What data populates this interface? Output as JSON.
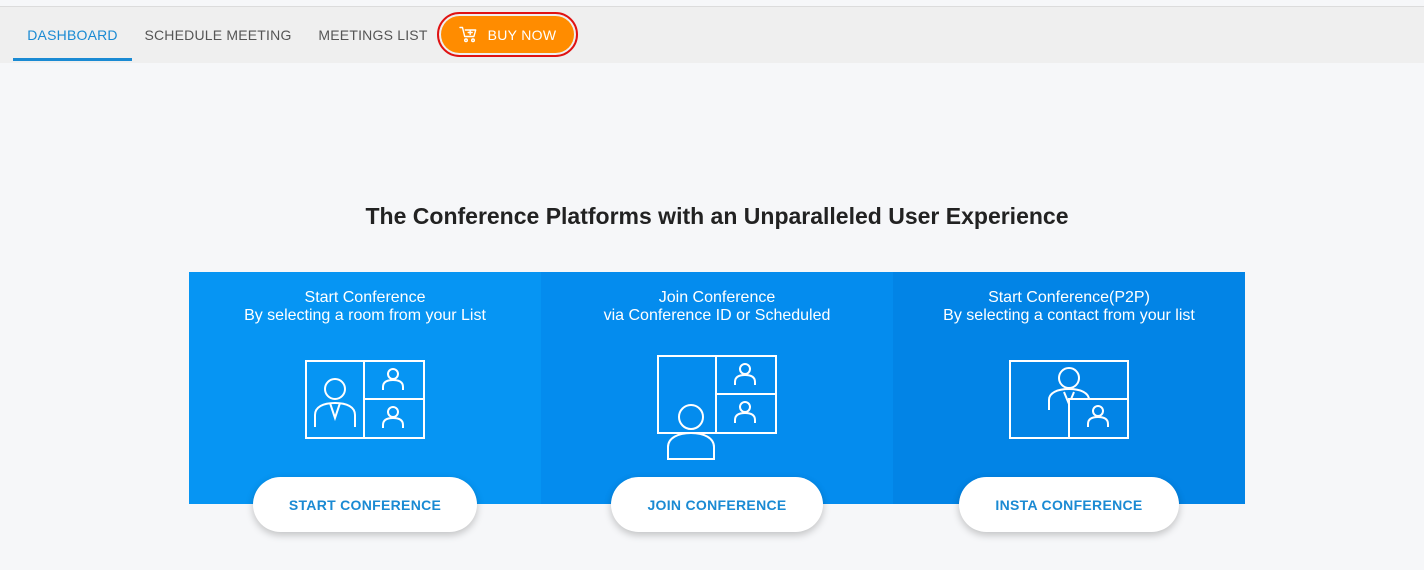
{
  "nav": {
    "tabs": [
      {
        "label": "DASHBOARD",
        "active": true
      },
      {
        "label": "SCHEDULE MEETING",
        "active": false
      },
      {
        "label": "MEETINGS LIST",
        "active": false
      }
    ],
    "buy_now": {
      "label": "BUY NOW",
      "icon": "cart-icon"
    }
  },
  "headline": "The Conference Platforms with an Unparalleled User Experience",
  "cards": [
    {
      "title": "Start Conference",
      "subtitle": "By selecting a room from your List",
      "button": "START CONFERENCE",
      "icon": "room-conference-icon",
      "bg": "#0695f3"
    },
    {
      "title": "Join Conference",
      "subtitle": "via Conference ID or Scheduled",
      "button": "JOIN CONFERENCE",
      "icon": "join-conference-icon",
      "bg": "#048cee"
    },
    {
      "title": "Start Conference(P2P)",
      "subtitle": "By selecting a contact from your list",
      "button": "INSTA CONFERENCE",
      "icon": "p2p-conference-icon",
      "bg": "#0284e6"
    }
  ],
  "colors": {
    "accent": "#1a8ad3",
    "buy_now": "#ff8c00",
    "highlight_ring": "#e01212"
  }
}
